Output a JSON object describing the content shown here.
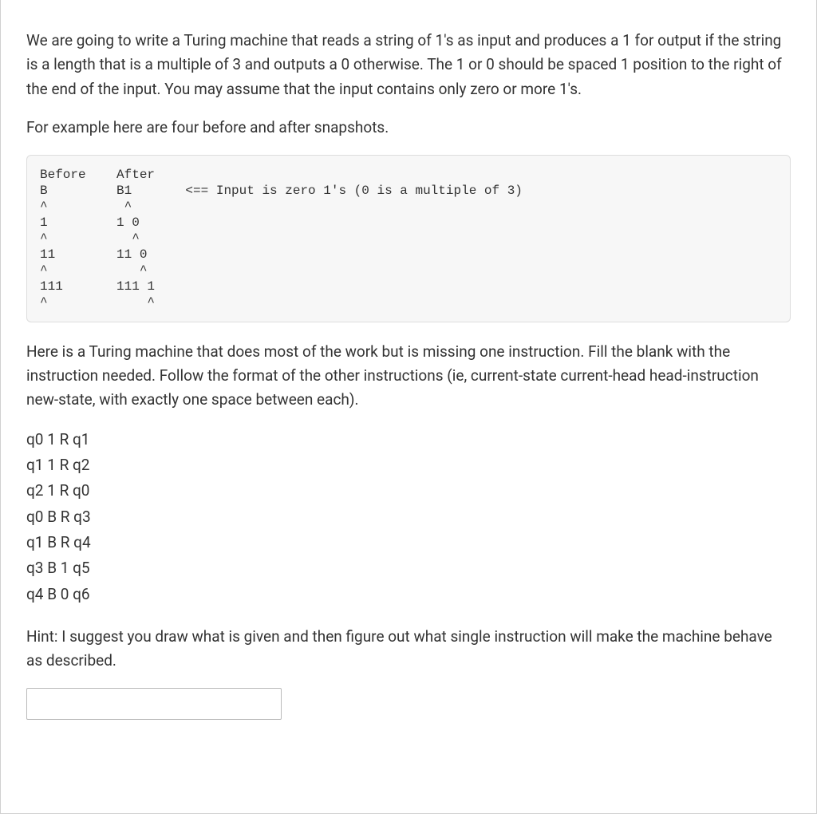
{
  "intro": {
    "p1": "We are going to write a Turing machine that reads a string of 1's as input and produces a 1 for output if the string is a length that is a multiple of 3 and outputs a 0 otherwise. The 1 or 0 should be spaced 1 position to the right of the end of the input. You may assume that the input contains only zero or more 1's.",
    "p2": "For example here are four before and after snapshots."
  },
  "code_block": "Before    After\nB         B1       <== Input is zero 1's (0 is a multiple of 3)\n^          ^\n1         1 0\n^           ^\n11        11 0\n^            ^\n111       111 1\n^             ^",
  "mid": {
    "p3": "Here is a Turing machine that does most of the work but is missing one instruction. Fill the blank with the instruction needed. Follow the format of the other instructions (ie, current-state current-head head-instruction new-state, with exactly one space between each)."
  },
  "instructions": {
    "i0": "q0 1 R q1",
    "i1": "q1 1 R q2",
    "i2": "q2 1 R q0",
    "i3": "q0 B R q3",
    "i4": "q1 B R q4",
    "i5": "q3 B 1 q5",
    "i6": "q4 B 0 q6"
  },
  "hint": "Hint: I suggest you draw what is given and then figure out what single instruction will make the machine behave as described.",
  "input": {
    "value": "",
    "placeholder": ""
  }
}
